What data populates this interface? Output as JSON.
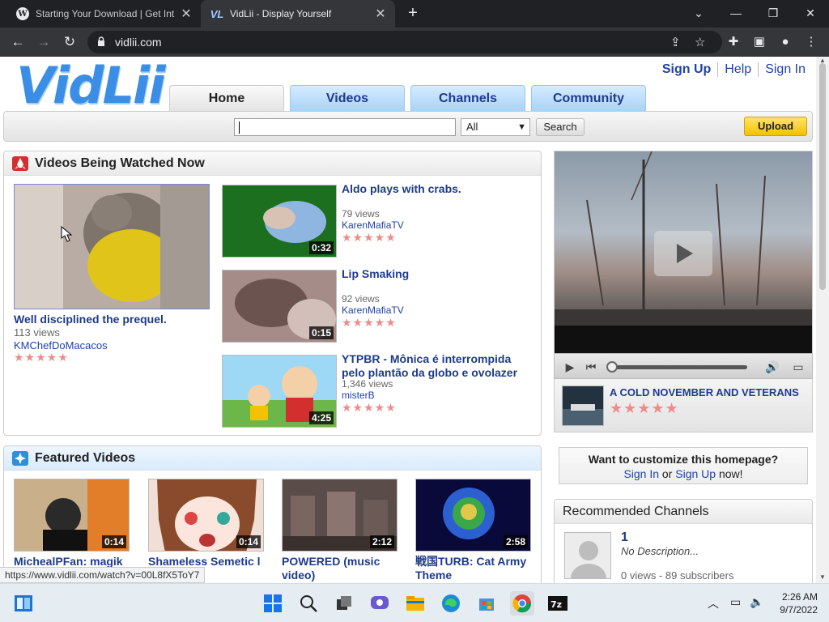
{
  "browser": {
    "tabs": [
      {
        "title": "Starting Your Download | Get Int",
        "icon": "wordpress-icon",
        "active": false
      },
      {
        "title": "VidLii - Display Yourself",
        "icon": "vidlii-icon",
        "active": true
      }
    ],
    "url": "vidlii.com",
    "status_url": "https://www.vidlii.com/watch?v=00L8fX5ToY7"
  },
  "site": {
    "logo": "VidLii",
    "userlinks": [
      "Sign Up",
      "Help",
      "Sign In"
    ],
    "nav": [
      "Home",
      "Videos",
      "Channels",
      "Community"
    ],
    "search": {
      "value": "",
      "category": "All",
      "button": "Search"
    },
    "upload": "Upload"
  },
  "watched": {
    "heading": "Videos Being Watched Now",
    "main": {
      "title": "Well disciplined the prequel.",
      "views": "113 views",
      "author": "KMChefDoMacacos",
      "stars": "★★★★★"
    },
    "list": [
      {
        "title": "Aldo plays with crabs.",
        "views": "79 views",
        "author": "KarenMafiaTV",
        "duration": "0:32",
        "stars": "★★★★★"
      },
      {
        "title": "Lip Smaking",
        "views": "92 views",
        "author": "KarenMafiaTV",
        "duration": "0:15",
        "stars": "★★★★★"
      },
      {
        "title": "YTPBR - Mônica é interrompida pelo plantão da globo e ovolazer",
        "views": "1,346 views",
        "author": "misterB",
        "duration": "4:25",
        "stars": "★★★★★"
      }
    ]
  },
  "featured": {
    "heading": "Featured Videos",
    "items": [
      {
        "title": "MichealPFan: magik",
        "duration": "0:14"
      },
      {
        "title": "Shameless Semetic l",
        "duration": "0:14"
      },
      {
        "title": "POWERED (music video)",
        "duration": "2:12"
      },
      {
        "title": "戦国TURB: Cat Army Theme",
        "duration": "2:58"
      }
    ]
  },
  "player": {
    "nowplaying_title": "A COLD NOVEMBER AND VETERANS",
    "stars": "★★★★★"
  },
  "customize": {
    "question": "Want to customize this homepage?",
    "sign_in": "Sign In",
    "or": "or",
    "sign_up": "Sign Up",
    "now": "now!"
  },
  "recommended": {
    "heading": "Recommended Channels",
    "channel": {
      "name": "1",
      "description": "No Description...",
      "stats": "0 views - 89 subscribers"
    }
  },
  "taskbar": {
    "time": "2:26 AM",
    "date": "9/7/2022"
  }
}
